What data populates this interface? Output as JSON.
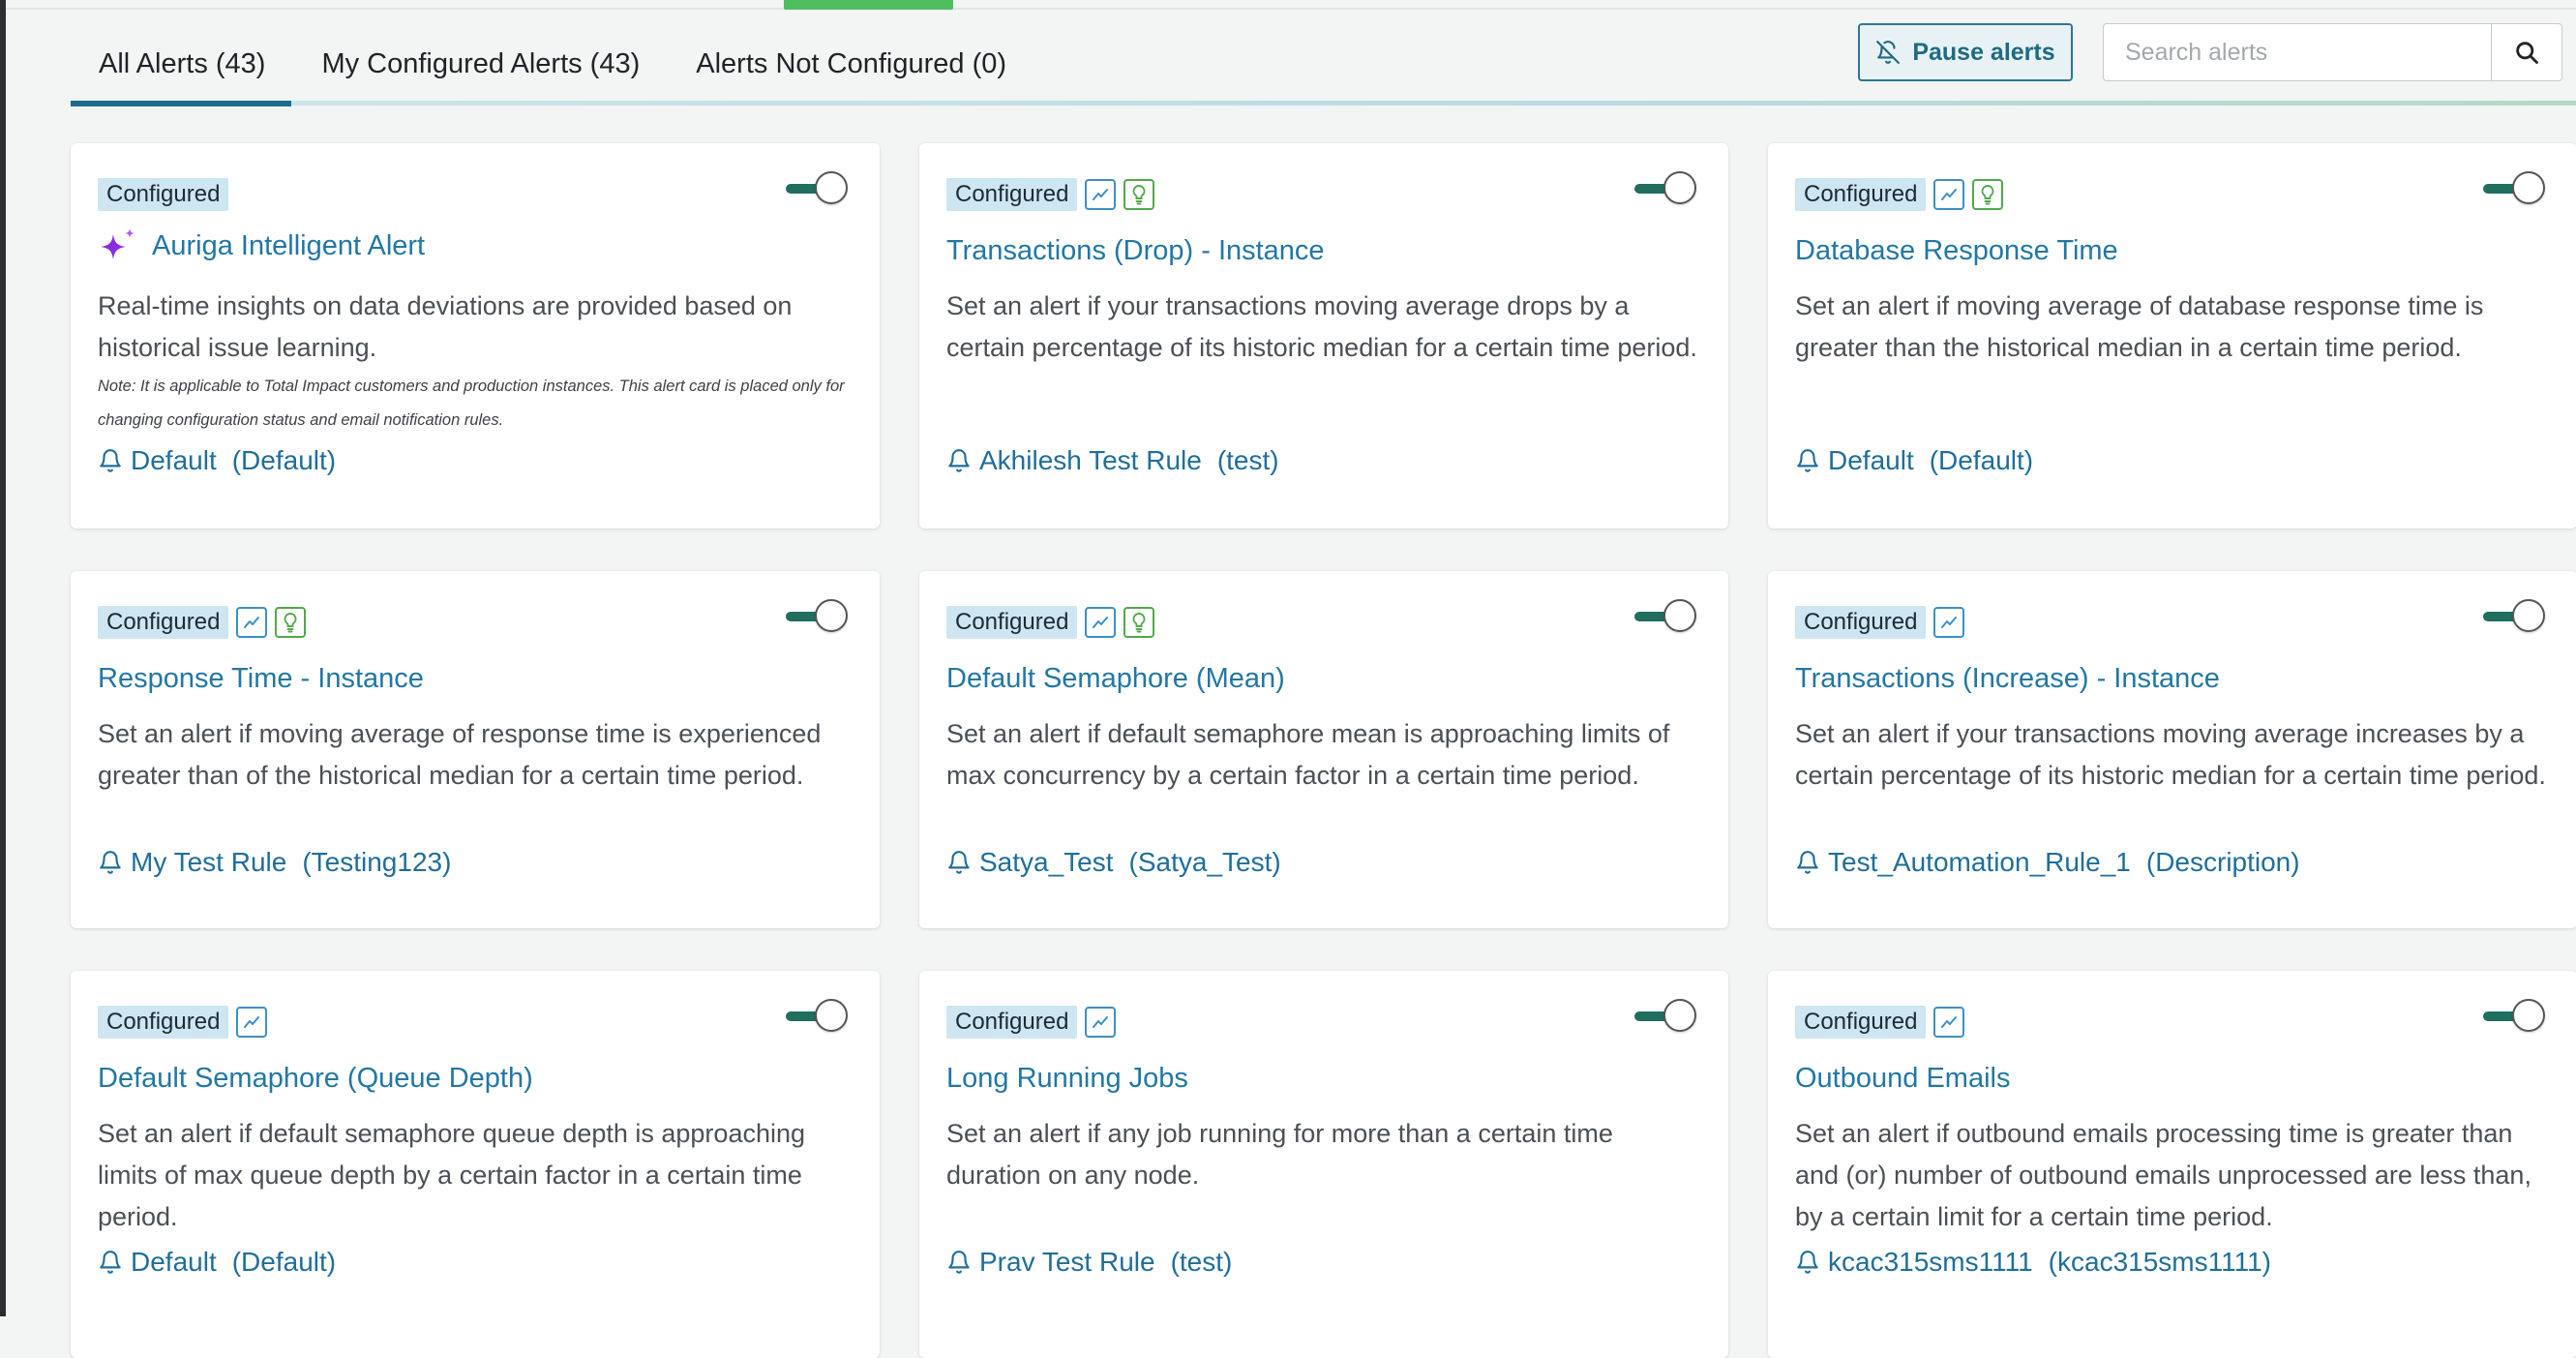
{
  "tabs": [
    {
      "label": "All Alerts (43)"
    },
    {
      "label": "My Configured Alerts (43)"
    },
    {
      "label": "Alerts Not Configured (0)"
    }
  ],
  "toolbar": {
    "pause_label": "Pause alerts",
    "search_placeholder": "Search alerts"
  },
  "colors": {
    "accent": "#1b6e8a",
    "link": "#2277a4",
    "toggle_on": "#1f6e5e",
    "badge_bg": "#cde6f2"
  },
  "cards": [
    {
      "badge": "Configured",
      "icons": [],
      "title": "Auriga Intelligent Alert",
      "description": "Real-time insights on data deviations are provided based on historical issue learning.",
      "note": "Note: It is applicable to Total Impact customers and production instances. This alert card is placed only for changing configuration status and email notification rules.",
      "rule_name": "Default",
      "rule_desc": "(Default)",
      "enabled": true
    },
    {
      "badge": "Configured",
      "icons": [
        "trend-icon",
        "bulb-icon"
      ],
      "title": "Transactions (Drop) - Instance",
      "description": "Set an alert if your transactions moving average drops by a certain percentage of its historic median for a certain time period.",
      "rule_name": "Akhilesh Test Rule",
      "rule_desc": "(test)",
      "enabled": true
    },
    {
      "badge": "Configured",
      "icons": [
        "trend-icon",
        "bulb-icon"
      ],
      "title": "Database Response Time",
      "description": "Set an alert if moving average of database response time is greater than the historical median in a certain time period.",
      "rule_name": "Default",
      "rule_desc": "(Default)",
      "enabled": true
    },
    {
      "badge": "Configured",
      "icons": [
        "trend-icon",
        "bulb-icon"
      ],
      "title": "Response Time - Instance",
      "description": "Set an alert if moving average of response time is experienced greater than of the historical median for a certain time period.",
      "rule_name": "My Test Rule",
      "rule_desc": "(Testing123)",
      "enabled": true
    },
    {
      "badge": "Configured",
      "icons": [
        "trend-icon",
        "bulb-icon"
      ],
      "title": "Default Semaphore (Mean)",
      "description": "Set an alert if default semaphore mean is approaching limits of max concurrency by a certain factor in a certain time period.",
      "rule_name": "Satya_Test",
      "rule_desc": "(Satya_Test)",
      "enabled": true
    },
    {
      "badge": "Configured",
      "icons": [
        "trend-icon"
      ],
      "title": "Transactions (Increase) - Instance",
      "description": "Set an alert if your transactions moving average increases by a certain percentage of its historic median for a certain time period.",
      "rule_name": "Test_Automation_Rule_1",
      "rule_desc": "(Description)",
      "enabled": true
    },
    {
      "badge": "Configured",
      "icons": [
        "trend-icon"
      ],
      "title": "Default Semaphore (Queue Depth)",
      "description": "Set an alert if default semaphore queue depth is approaching limits of max queue depth by a certain factor in a certain time period.",
      "rule_name": "Default",
      "rule_desc": "(Default)",
      "enabled": true
    },
    {
      "badge": "Configured",
      "icons": [
        "trend-icon"
      ],
      "title": "Long Running Jobs",
      "description": "Set an alert if any job running for more than a certain time duration on any node.",
      "rule_name": "Prav Test Rule",
      "rule_desc": "(test)",
      "enabled": true
    },
    {
      "badge": "Configured",
      "icons": [
        "trend-icon"
      ],
      "title": "Outbound Emails",
      "description": "Set an alert if outbound emails processing time is greater than and (or) number of outbound emails unprocessed are less than, by a certain limit for a certain time period.",
      "rule_name": "kcac315sms1111",
      "rule_desc": "(kcac315sms1111)",
      "enabled": true
    }
  ]
}
